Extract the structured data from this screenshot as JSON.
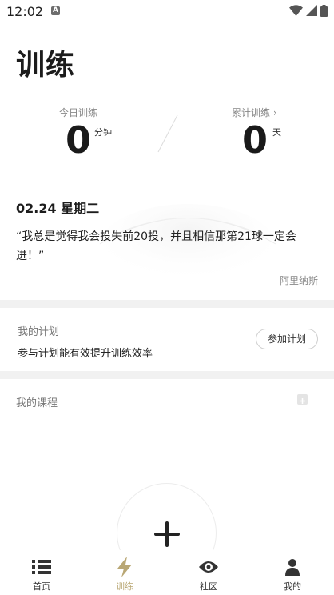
{
  "status_bar": {
    "time": "12:02",
    "notification_badge": "A"
  },
  "page": {
    "title": "训练"
  },
  "stats": {
    "today_label": "今日训练",
    "today_value": "0",
    "today_unit": "分钟",
    "total_label": "累计训练 ›",
    "total_value": "0",
    "total_unit": "天"
  },
  "quote_card": {
    "date": "02.24 星期二",
    "quote": "“我总是觉得我会投失前20投，并且相信那第21球一定会进！”",
    "author": "阿里纳斯"
  },
  "plan": {
    "title": "我的计划",
    "description": "参与计划能有效提升训练效率",
    "button_label": "参加计划"
  },
  "courses": {
    "title": "我的课程"
  },
  "tab_bar": {
    "items": [
      {
        "label": "首页",
        "icon": "list-icon"
      },
      {
        "label": "训练",
        "icon": "lightning-icon"
      },
      {
        "label": "社区",
        "icon": "eye-icon"
      },
      {
        "label": "我的",
        "icon": "person-icon"
      }
    ],
    "active_color": "#b9a774",
    "inactive_color": "#333333"
  }
}
